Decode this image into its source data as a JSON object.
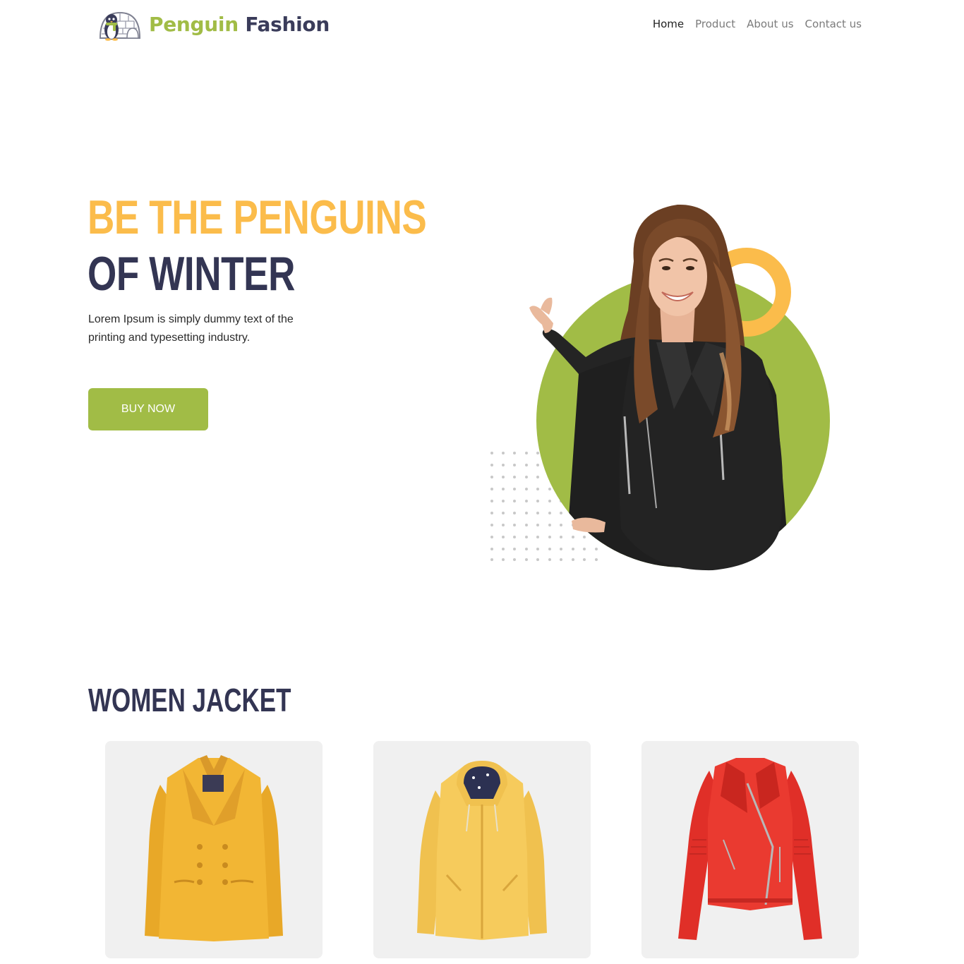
{
  "brand": {
    "name_part1": "Penguin",
    "name_part2": "Fashion",
    "logo_icon": "penguin-igloo-icon",
    "colors": {
      "green": "#a1bc46",
      "navy": "#3a3c5a",
      "yellow": "#fbbc4b"
    }
  },
  "nav": {
    "items": [
      {
        "label": "Home",
        "active": true
      },
      {
        "label": "Product"
      },
      {
        "label": "About us"
      },
      {
        "label": "Contact us"
      }
    ]
  },
  "hero": {
    "title_line1": "BE THE PENGUINS",
    "title_line2": "OF WINTER",
    "description": "Lorem Ipsum is simply dummy text of the printing and typesetting industry.",
    "cta_label": "BUY NOW"
  },
  "products": {
    "section_title": "WOMEN JACKET",
    "items": [
      {
        "image": "yellow-wool-coat",
        "color": "#f0b631"
      },
      {
        "image": "yellow-hooded-jacket",
        "color": "#f4c95a"
      },
      {
        "image": "red-leather-jacket",
        "color": "#e8312a"
      }
    ]
  }
}
